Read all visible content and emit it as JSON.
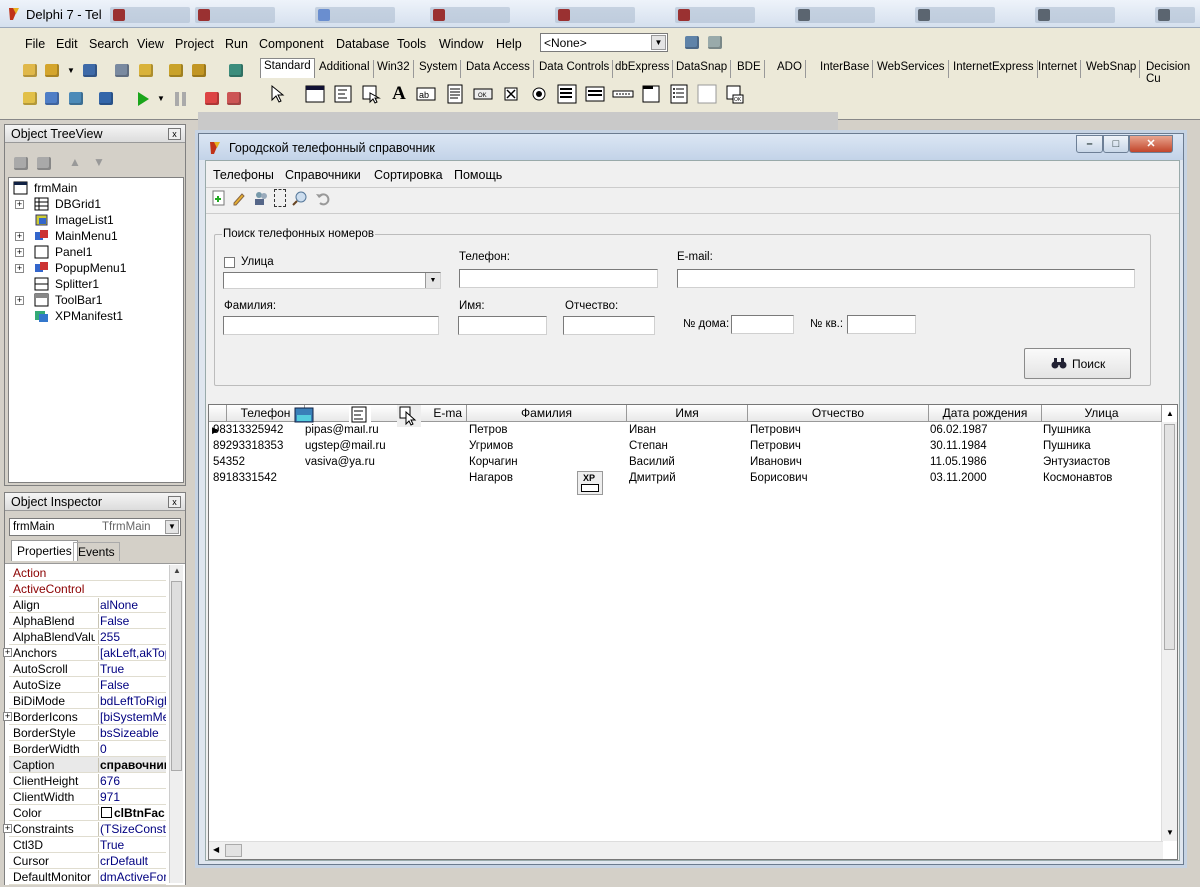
{
  "ide": {
    "title": "Delphi 7 - Tel",
    "menu": [
      "File",
      "Edit",
      "Search",
      "View",
      "Project",
      "Run",
      "Component",
      "Database",
      "Tools",
      "Window",
      "Help"
    ],
    "desktop_combo": "<None>",
    "palette_tabs": [
      "Standard",
      "Additional",
      "Win32",
      "System",
      "Data Access",
      "Data Controls",
      "dbExpress",
      "DataSnap",
      "BDE",
      "ADO",
      "InterBase",
      "WebServices",
      "InternetExpress",
      "Internet",
      "WebSnap",
      "Decision Cu"
    ]
  },
  "tree_view": {
    "title": "Object TreeView",
    "close": "x",
    "root": "frmMain",
    "items": [
      {
        "name": "DBGrid1",
        "expandable": true
      },
      {
        "name": "ImageList1",
        "expandable": false
      },
      {
        "name": "MainMenu1",
        "expandable": true
      },
      {
        "name": "Panel1",
        "expandable": true
      },
      {
        "name": "PopupMenu1",
        "expandable": true
      },
      {
        "name": "Splitter1",
        "expandable": false
      },
      {
        "name": "ToolBar1",
        "expandable": true
      },
      {
        "name": "XPManifest1",
        "expandable": false
      }
    ]
  },
  "inspector": {
    "title": "Object Inspector",
    "close": "x",
    "object_name": "frmMain",
    "object_type": "TfrmMain",
    "tabs": [
      "Properties",
      "Events"
    ],
    "props": [
      {
        "n": "Action",
        "v": "",
        "red": true
      },
      {
        "n": "ActiveControl",
        "v": "",
        "red": true
      },
      {
        "n": "Align",
        "v": "alNone"
      },
      {
        "n": "AlphaBlend",
        "v": "False"
      },
      {
        "n": "AlphaBlendValu",
        "v": "255"
      },
      {
        "n": "Anchors",
        "v": "[akLeft,akTop",
        "plus": true
      },
      {
        "n": "AutoScroll",
        "v": "True"
      },
      {
        "n": "AutoSize",
        "v": "False"
      },
      {
        "n": "BiDiMode",
        "v": "bdLeftToRight"
      },
      {
        "n": "BorderIcons",
        "v": "[biSystemMen",
        "plus": true
      },
      {
        "n": "BorderStyle",
        "v": "bsSizeable"
      },
      {
        "n": "BorderWidth",
        "v": "0"
      },
      {
        "n": "Caption",
        "v": "справочник",
        "sel": true
      },
      {
        "n": "ClientHeight",
        "v": "676"
      },
      {
        "n": "ClientWidth",
        "v": "971"
      },
      {
        "n": "Color",
        "v": "clBtnFac",
        "swatch": true
      },
      {
        "n": "Constraints",
        "v": "(TSizeConstra",
        "plus": true
      },
      {
        "n": "Ctl3D",
        "v": "True"
      },
      {
        "n": "Cursor",
        "v": "crDefault"
      },
      {
        "n": "DefaultMonitor",
        "v": "dmActiveForm"
      }
    ]
  },
  "form": {
    "title": "Городской телефонный справочник",
    "menu": [
      "Телефоны",
      "Справочники",
      "Сортировка",
      "Помощь"
    ],
    "search": {
      "group_title": "Поиск телефонных номеров",
      "street_check": "Улица",
      "phone_label": "Телефон:",
      "email_label": "E-mail:",
      "surname_label": "Фамилия:",
      "name_label": "Имя:",
      "patronymic_label": "Отчество:",
      "house_label": "№ дома:",
      "flat_label": "№ кв.:",
      "search_button": "Поиск"
    },
    "grid": {
      "columns": [
        "Телефон",
        "E-ma",
        "Фамилия",
        "Имя",
        "Отчество",
        "Дата рождения",
        "Улица"
      ],
      "rows": [
        [
          "98313325942",
          "pipas@mail.ru",
          "Петров",
          "Иван",
          "Петрович",
          "06.02.1987",
          "Пушника"
        ],
        [
          "89293318353",
          "ugstep@mail.ru",
          "Угримов",
          "Степан",
          "Петрович",
          "30.11.1984",
          "Пушника"
        ],
        [
          "54352",
          "vasiva@ya.ru",
          "Корчагин",
          "Василий",
          "Иванович",
          "11.05.1986",
          "Энтузиастов"
        ],
        [
          "8918331542",
          "",
          "Нагаров",
          "Дмитрий",
          "Борисович",
          "03.11.2000",
          "Космонавтов"
        ]
      ]
    },
    "xp_badge": "XP"
  }
}
